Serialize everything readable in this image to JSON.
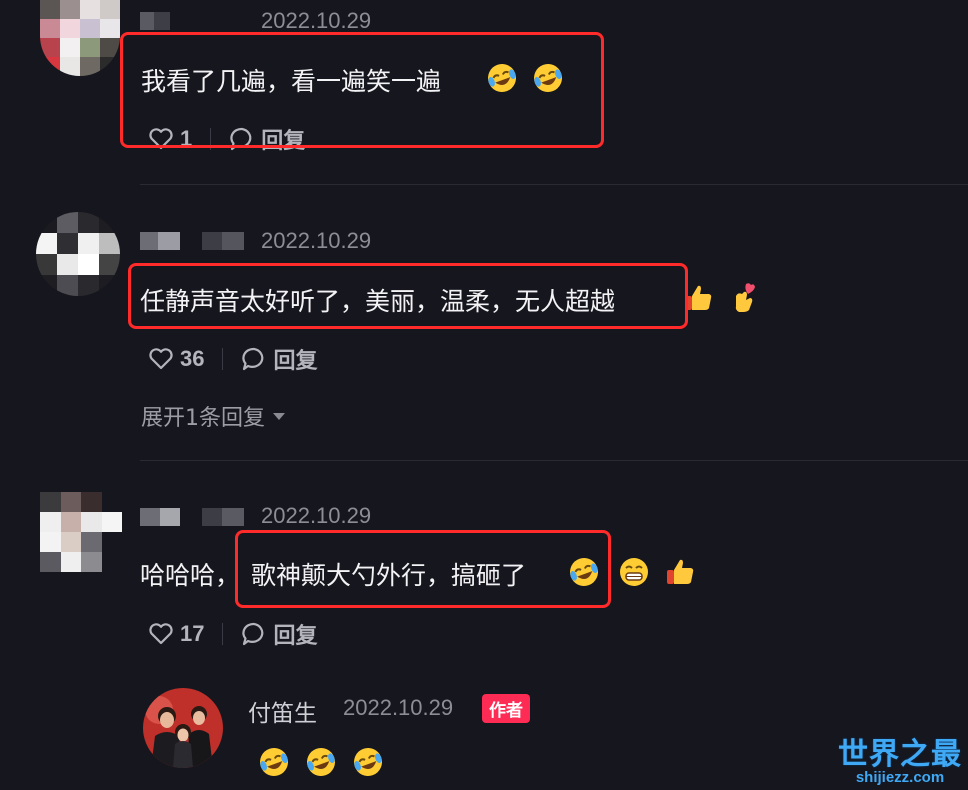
{
  "comments": [
    {
      "date": "2022.10.29",
      "text": "我看了几遍，看一遍笑一遍",
      "likes": "1",
      "reply_label": "回复",
      "emojis": [
        "laughing-tears-emoji",
        "laughing-tears-emoji"
      ]
    },
    {
      "date": "2022.10.29",
      "text": "任静声音太好听了，美丽，温柔，无人超越",
      "likes": "36",
      "reply_label": "回复",
      "emojis": [
        "thumbs-up-emoji",
        "finger-heart-emoji"
      ],
      "expand_label": "展开1条回复"
    },
    {
      "date": "2022.10.29",
      "text_prefix": "哈哈哈，",
      "text": "歌神颠大勺外行，搞砸了",
      "likes": "17",
      "reply_label": "回复",
      "emojis": [
        "laughing-tears-emoji",
        "grinning-emoji",
        "thumbs-up-emoji"
      ]
    }
  ],
  "reply": {
    "author": "付笛生",
    "date": "2022.10.29",
    "badge": "作者",
    "emojis": [
      "laughing-tears-emoji",
      "laughing-tears-emoji",
      "laughing-tears-emoji"
    ]
  },
  "watermark": {
    "title": "世界之最",
    "url": "shijiezz.com"
  },
  "colors": {
    "background": "#16161e",
    "highlight_box": "#ff2a2a",
    "author_badge": "#fe2c55",
    "watermark": "#3fa9f5"
  }
}
